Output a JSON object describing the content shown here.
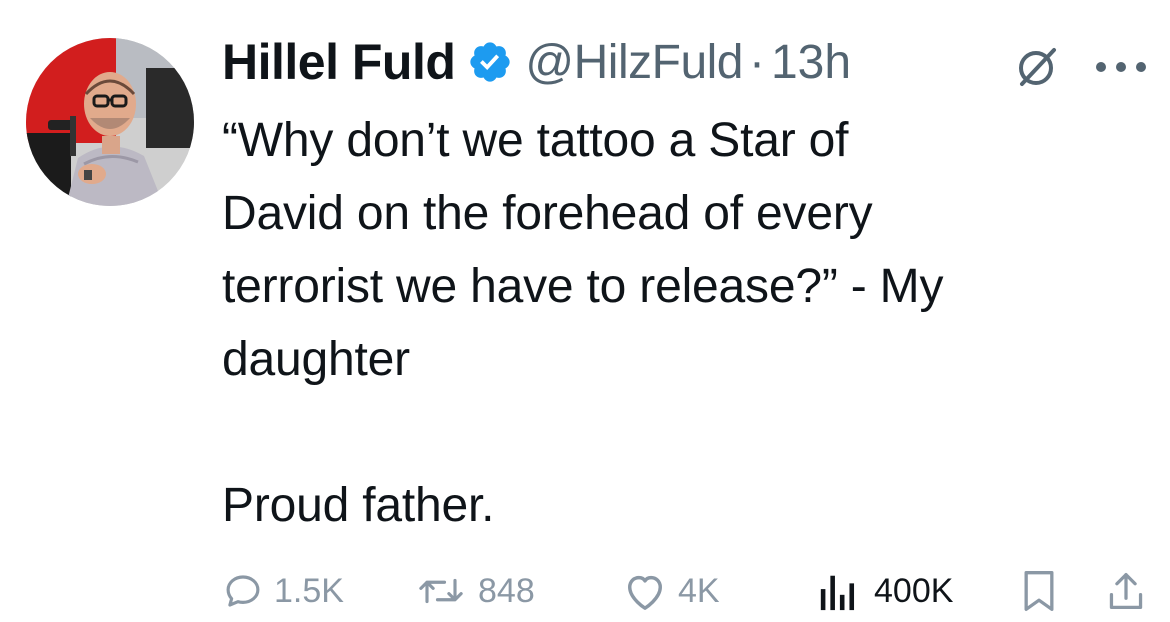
{
  "author": {
    "name": "Hillel Fuld",
    "handle": "@HilzFuld",
    "separator": "·",
    "time": "13h",
    "verified": true
  },
  "tweet": {
    "text": "“Why don’t we tattoo a Star of\nDavid on the forehead of every\nterrorist we have to release?” - My\ndaughter\n\nProud father."
  },
  "metrics": {
    "replies": "1.5K",
    "reposts": "848",
    "likes": "4K",
    "views": "400K"
  },
  "icons": {
    "verified": "verified-badge-icon",
    "grok": "grok-icon",
    "more": "more-icon",
    "reply": "reply-icon",
    "repost": "repost-icon",
    "like": "like-icon",
    "views": "views-icon",
    "bookmark": "bookmark-icon",
    "share": "share-icon"
  },
  "colors": {
    "verified_blue": "#1d9bf0",
    "muted": "#536471",
    "action_gray": "#8b98a5",
    "text": "#0f1419"
  }
}
